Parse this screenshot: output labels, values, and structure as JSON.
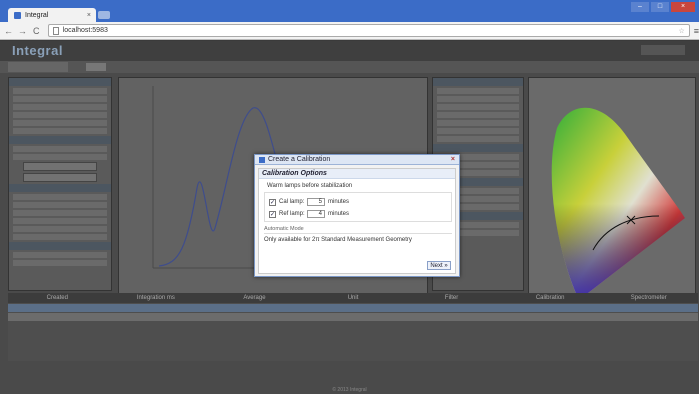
{
  "browser": {
    "tab_title": "Integral",
    "tab_close": "×",
    "url": "localhost:5983",
    "nav_back": "←",
    "nav_forward": "→",
    "nav_reload": "C",
    "wrench": "≡",
    "star": "☆"
  },
  "app": {
    "logo": "Integral",
    "footer": "© 2013 Integral"
  },
  "dialog": {
    "title": "Create a Calibration",
    "close": "×",
    "options_header": "Calibration Options",
    "warm_label": "Warm lamps before stabilization",
    "cal_lamp": {
      "label": "Cal lamp:",
      "value": "5",
      "unit": "minutes",
      "checked": "✓"
    },
    "ref_lamp": {
      "label": "Ref lamp:",
      "value": "4",
      "unit": "minutes",
      "checked": "✓"
    },
    "auto_title": "Automatic Mode",
    "auto_text": "Only available for 2π Standard Measurement Geometry",
    "next_button": "Next »"
  },
  "table": {
    "headers": [
      "Created",
      "Integration ms",
      "Average",
      "Unit",
      "Filter",
      "Calibration",
      "Spectrometer"
    ]
  },
  "colors": {
    "chrome_blue": "#3b6cc7",
    "dialog_header": "#dde6f4"
  }
}
